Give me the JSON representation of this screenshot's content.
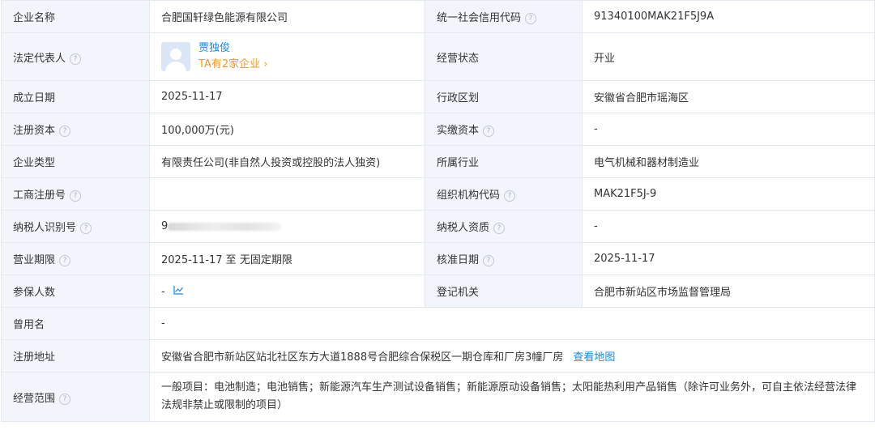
{
  "rows": {
    "r1": {
      "l1": "企业名称",
      "v1": "合肥国轩绿色能源有限公司",
      "l2": "统一社会信用代码",
      "v2": "91340100MAK21F5J9A"
    },
    "r2": {
      "l1": "法定代表人",
      "person_name": "贾独俊",
      "person_count": "TA有2家企业 ›",
      "l2": "经营状态",
      "v2": "开业"
    },
    "r3": {
      "l1": "成立日期",
      "v1": "2025-11-17",
      "l2": "行政区划",
      "v2": "安徽省合肥市瑶海区"
    },
    "r4": {
      "l1": "注册资本",
      "v1": "100,000万(元)",
      "l2": "实缴资本",
      "v2": "-"
    },
    "r5": {
      "l1": "企业类型",
      "v1": "有限责任公司(非自然人投资或控股的法人独资)",
      "l2": "所属行业",
      "v2": "电气机械和器材制造业"
    },
    "r6": {
      "l1": "工商注册号",
      "v1": "",
      "l2": "组织机构代码",
      "v2": "MAK21F5J-9"
    },
    "r7": {
      "l1": "纳税人识别号",
      "v1": "9",
      "l2": "纳税人资质",
      "v2": "-"
    },
    "r8": {
      "l1": "营业期限",
      "v1": "2025-11-17 至 无固定期限",
      "l2": "核准日期",
      "v2": "2025-11-17"
    },
    "r9": {
      "l1": "参保人数",
      "v1": "-",
      "l2": "登记机关",
      "v2": "合肥市新站区市场监督管理局"
    },
    "r10": {
      "l1": "曾用名",
      "v1": "-"
    },
    "r11": {
      "l1": "注册地址",
      "v1": "安徽省合肥市新站区站北社区东方大道1888号合肥综合保税区一期仓库和厂房3幢厂房",
      "link": "查看地图"
    },
    "r12": {
      "l1": "经营范围",
      "v1": "一般项目：电池制造；电池销售；新能源汽车生产测试设备销售；新能源原动设备销售；太阳能热利用产品销售（除许可业务外，可自主依法经营法律法规非禁止或限制的项目）"
    }
  },
  "icons": {
    "help": "question-circle-icon",
    "trend": "trend-chart-icon",
    "avatar": "avatar-placeholder"
  },
  "colors": {
    "label_bg": "#f2f6fc",
    "border": "#e4e9f1",
    "link": "#128bed",
    "orange": "#f59a23"
  }
}
